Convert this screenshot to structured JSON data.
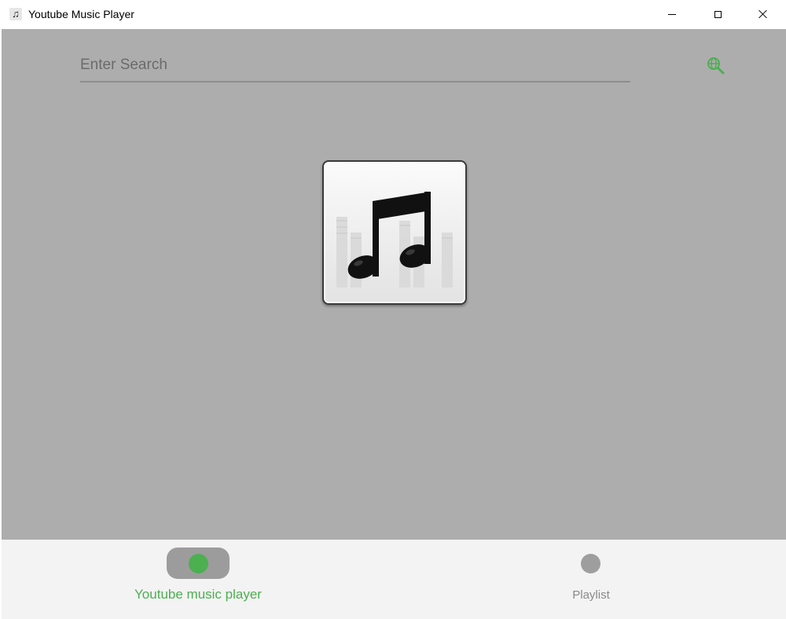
{
  "window": {
    "title": "Youtube Music Player",
    "app_icon": "music-note-icon"
  },
  "titlebar_controls": {
    "minimize_icon": "minimize-icon",
    "maximize_icon": "maximize-icon",
    "close_icon": "close-icon"
  },
  "search": {
    "placeholder": "Enter Search",
    "value": "",
    "button_icon": "globe-search-icon"
  },
  "album_art": {
    "icon": "music-note-icon"
  },
  "bottom_nav": {
    "items": [
      {
        "label": "Youtube music player",
        "selected": true
      },
      {
        "label": "Playlist",
        "selected": false
      }
    ]
  },
  "colors": {
    "accent": "#4caf50",
    "content_background": "#adadad",
    "nav_background": "#f3f3f3",
    "inactive": "#9e9e9e"
  }
}
